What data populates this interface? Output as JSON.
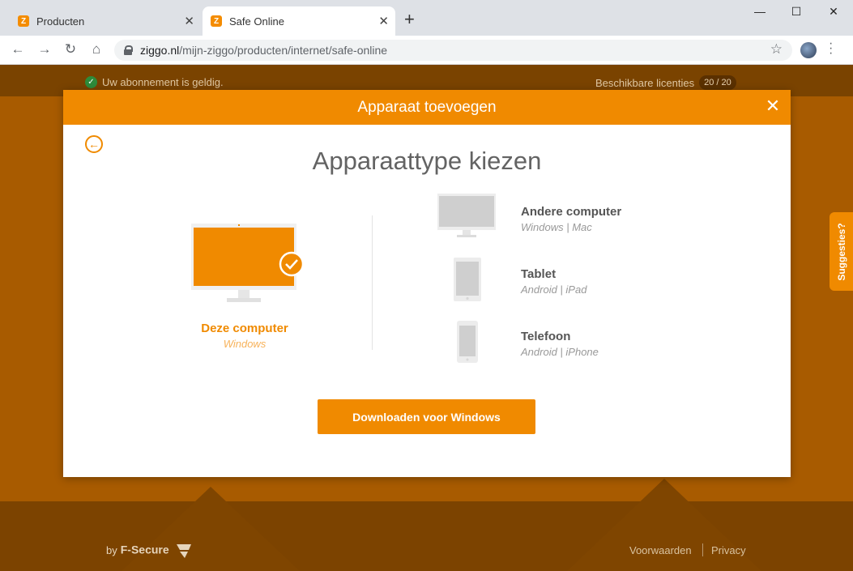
{
  "browser": {
    "tabs": [
      {
        "title": "Producten",
        "favicon": "ziggo-icon"
      },
      {
        "title": "Safe Online",
        "favicon": "ziggo-icon"
      }
    ],
    "url_host": "ziggo.nl",
    "url_path": "/mijn-ziggo/producten/internet/safe-online"
  },
  "page": {
    "status": "Uw abonnement is geldig.",
    "licenses_label": "Beschikbare licenties",
    "licenses_count": "20 / 20",
    "footer_by": "by",
    "footer_brand": "F-Secure",
    "footer_links": [
      "Voorwaarden",
      "Privacy"
    ],
    "suggestions": "Suggesties?"
  },
  "modal": {
    "title": "Apparaat toevoegen",
    "heading": "Apparaattype kiezen",
    "selected": {
      "label": "Deze computer",
      "sub": "Windows"
    },
    "options": [
      {
        "title": "Andere computer",
        "sub": "Windows | Mac",
        "icon": "desktop-icon"
      },
      {
        "title": "Tablet",
        "sub": "Android | iPad",
        "icon": "tablet-icon"
      },
      {
        "title": "Telefoon",
        "sub": "Android | iPhone",
        "icon": "phone-icon"
      }
    ],
    "download_label": "Downloaden voor Windows"
  },
  "colors": {
    "accent": "#f08a00",
    "page_bg": "#a85b00"
  }
}
